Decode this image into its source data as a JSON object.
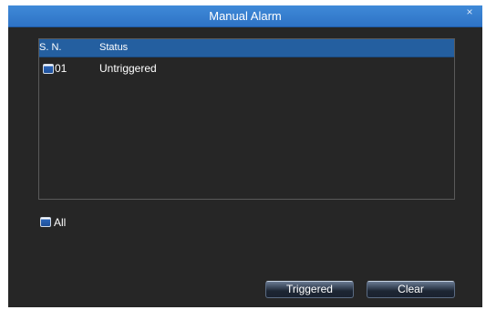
{
  "dialog": {
    "title": "Manual Alarm",
    "close_glyph": "×"
  },
  "list": {
    "headers": {
      "sn": "S. N.",
      "status": "Status"
    },
    "rows": [
      {
        "sn": "01",
        "status": "Untriggered",
        "checked": false
      }
    ]
  },
  "select_all": {
    "label": "All",
    "checked": false
  },
  "buttons": {
    "triggered": "Triggered",
    "clear": "Clear"
  },
  "colors": {
    "title_bar": "#2e73c5",
    "header_row": "#245fa0",
    "background": "#262626"
  },
  "icons": {
    "close": "close-icon",
    "checkbox": "checkbox-icon"
  }
}
